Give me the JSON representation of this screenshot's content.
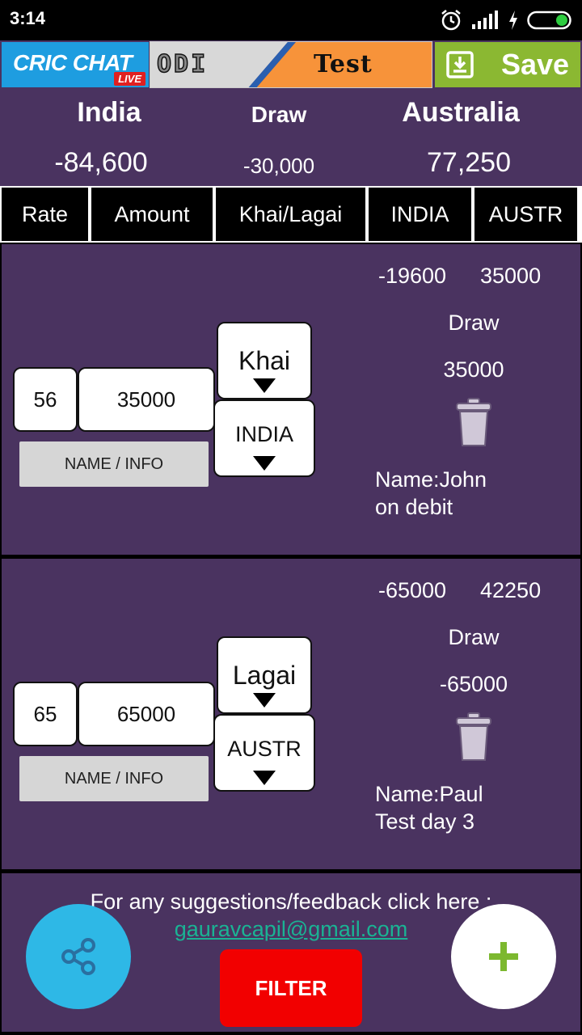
{
  "status_bar": {
    "time": "3:14",
    "icons": [
      "alarm-icon",
      "signal-icon",
      "charging-icon",
      "battery-icon"
    ]
  },
  "top_bar": {
    "logo_text": "CRIC CHAT",
    "logo_badge": "LIVE",
    "format_options": [
      "ODI",
      "Test"
    ],
    "save_label": "Save"
  },
  "summary": {
    "team1": {
      "name": "India",
      "total": "-84,600"
    },
    "draw": {
      "name": "Draw",
      "total": "-30,000"
    },
    "team2": {
      "name": "Australia",
      "total": "77,250"
    }
  },
  "columns": [
    "Rate",
    "Amount",
    "Khai/Lagai",
    "INDIA",
    "AUSTR"
  ],
  "entries": [
    {
      "rate": "56",
      "amount": "35000",
      "name_info_label": "NAME / INFO",
      "khai_lagai": "Khai",
      "team": "INDIA",
      "india_value": "-19600",
      "austr_value": "35000",
      "draw_label": "Draw",
      "draw_value": "35000",
      "note_line1": "Name:John",
      "note_line2": "on debit"
    },
    {
      "rate": "65",
      "amount": "65000",
      "name_info_label": "NAME / INFO",
      "khai_lagai": "Lagai",
      "team": "AUSTR",
      "india_value": "-65000",
      "austr_value": "42250",
      "draw_label": "Draw",
      "draw_value": "-65000",
      "note_line1": "Name:Paul",
      "note_line2": "Test day 3"
    }
  ],
  "footer": {
    "feedback_text": "For any suggestions/feedback click here :",
    "email": "gauravcapil@gmail.com",
    "filter_label": "FILTER"
  },
  "colors": {
    "panel": "#4a3360",
    "logo_bg": "#1e9de0",
    "save_bg": "#8bb832",
    "filter_bg": "#f20000",
    "share_fab": "#2eb8e6",
    "add_icon": "#7cb82f",
    "link": "#1ab394"
  }
}
